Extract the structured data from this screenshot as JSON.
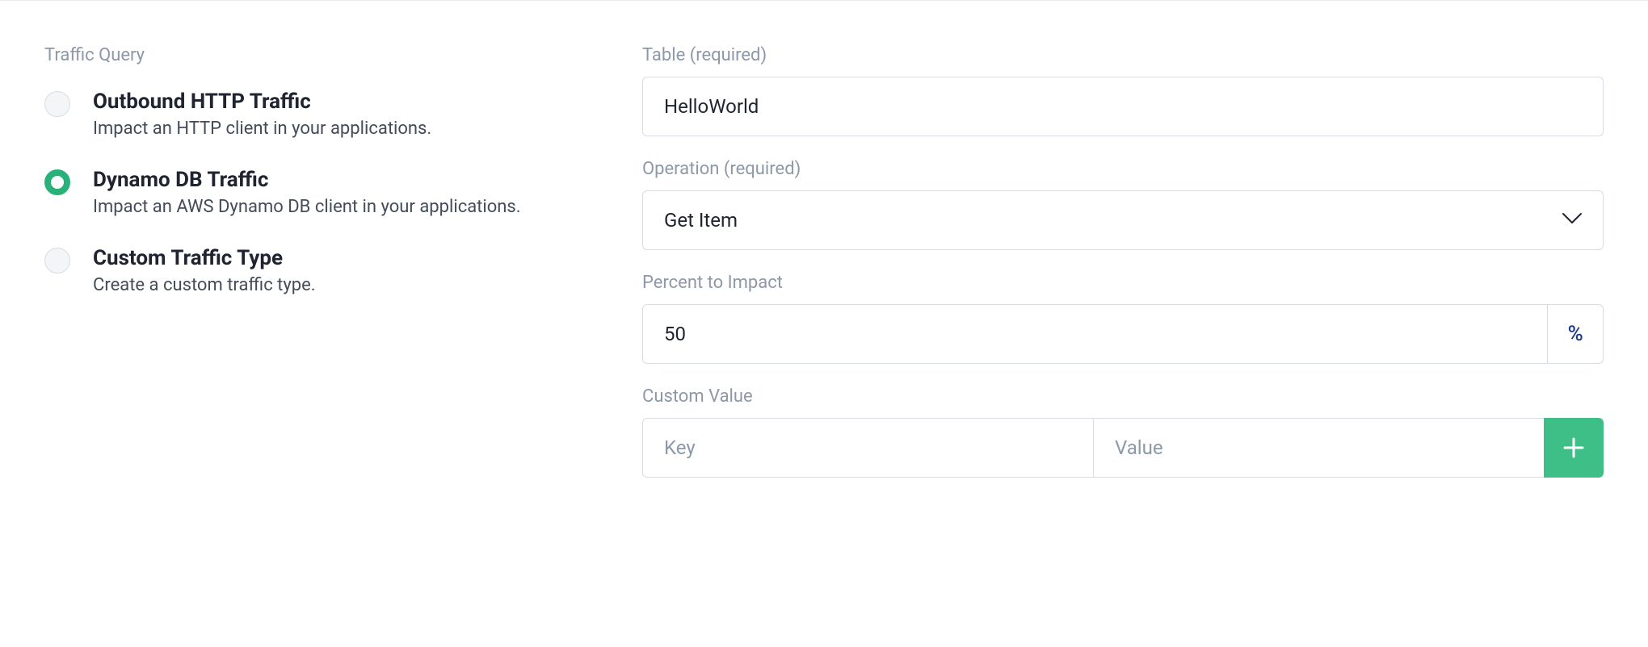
{
  "left": {
    "section_label": "Traffic Query",
    "options": [
      {
        "title": "Outbound HTTP Traffic",
        "desc": "Impact an HTTP client in your applications.",
        "selected": false
      },
      {
        "title": "Dynamo DB Traffic",
        "desc": "Impact an AWS Dynamo DB client in your applications.",
        "selected": true
      },
      {
        "title": "Custom Traffic Type",
        "desc": "Create a custom traffic type.",
        "selected": false
      }
    ]
  },
  "right": {
    "table": {
      "label": "Table (required)",
      "value": "HelloWorld"
    },
    "operation": {
      "label": "Operation (required)",
      "value": "Get Item"
    },
    "percent": {
      "label": "Percent to Impact",
      "value": "50",
      "unit": "%"
    },
    "custom": {
      "label": "Custom Value",
      "key_placeholder": "Key",
      "value_placeholder": "Value"
    }
  }
}
